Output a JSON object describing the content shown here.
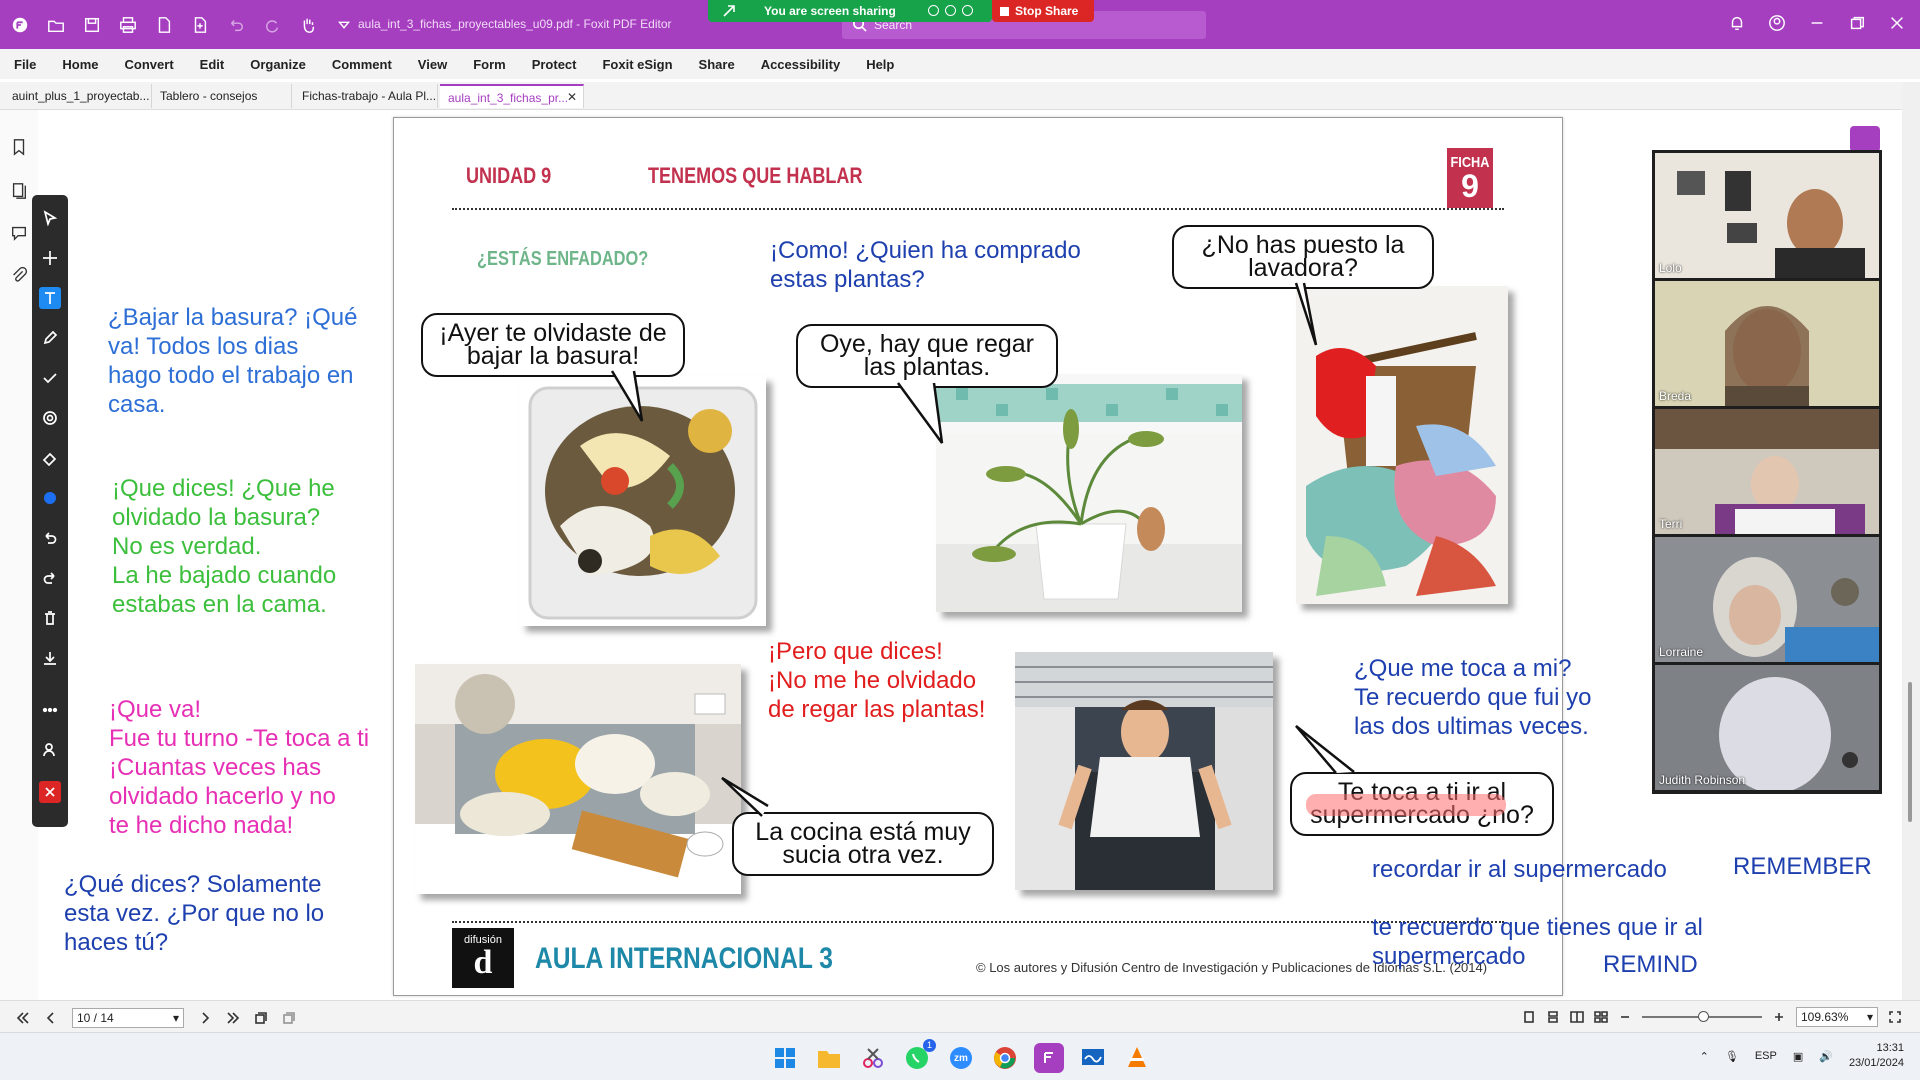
{
  "titlebar": {
    "doc_title": "aula_int_3_fichas_proyectables_u09.pdf - Foxit PDF Editor",
    "search_placeholder": "Search",
    "share_status": "You are screen sharing",
    "stop_share": "Stop Share"
  },
  "menu": [
    "File",
    "Home",
    "Convert",
    "Edit",
    "Organize",
    "Comment",
    "View",
    "Form",
    "Protect",
    "Foxit eSign",
    "Share",
    "Accessibility",
    "Help"
  ],
  "tabs": [
    {
      "label": "auint_plus_1_proyectab..."
    },
    {
      "label": "Tablero - consejos"
    },
    {
      "label": "Fichas-trabajo - Aula Pl..."
    },
    {
      "label": "aula_int_3_fichas_pr...",
      "active": true
    }
  ],
  "document": {
    "unit": "UNIDAD 9",
    "unit_title": "TENEMOS QUE HABLAR",
    "ficha_label": "FICHA",
    "ficha_number": "9",
    "subheading": "¿ESTÁS ENFADADO?",
    "bubbles": {
      "basura": "¡Ayer te olvidaste de bajar la basura!",
      "plantas": "Oye, hay que regar las plantas.",
      "lavadora": "¿No has puesto la lavadora?",
      "cocina": "La cocina está muy sucia otra vez.",
      "super": "Te toca a ti ir al supermercado ¿no?"
    },
    "footer_logo_top": "difusión",
    "footer_logo_mark": "d",
    "footer_title": "AULA INTERNACIONAL 3",
    "copyright": "© Los autores y Difusión Centro de Investigación y Publicaciones de Idiomas S.L. (2014)"
  },
  "annotations": {
    "bajar_basura": "¿Bajar la basura? ¡Qué\nva! Todos los dias\nhago todo el trabajo en\ncasa.",
    "que_dices_green": "¡Que dices! ¿Que he\nolvidado la basura?\nNo es verdad.\nLa he bajado cuando\nestabas en la cama.",
    "que_va_pink": "¡Que va!\nFue tu turno -Te toca a ti\n¡Cuantas veces has\nolvidado hacerlo y no\nte he dicho nada!",
    "solamente": "¿Qué dices? Solamente\nesta vez. ¿Por que no lo\nhaces tú?",
    "como_plantas": "¡Como! ¿Quien ha comprado\nestas plantas?",
    "pero_red": "¡Pero que dices!\n¡No me he olvidado\nde regar las plantas!",
    "que_me_toca": "¿Que me toca a mi?\nTe recuerdo que fui yo\nlas dos ultimas veces.",
    "recordar": "recordar ir al supermercado",
    "remember": "REMEMBER",
    "te_recuerdo": "te recuerdo que tienes que ir al\nsupermercado",
    "remind": "REMIND"
  },
  "participants": [
    "Lolo",
    "Breda",
    "Terri",
    "Lorraine",
    "Judith Robinson"
  ],
  "statusbar": {
    "page_indicator": "10 / 14",
    "zoom": "109.63%"
  },
  "taskbar": {
    "whatsapp_badge": "1",
    "zoom_label": "zm",
    "language": "ESP",
    "time": "13:31",
    "date": "23/01/2024"
  }
}
